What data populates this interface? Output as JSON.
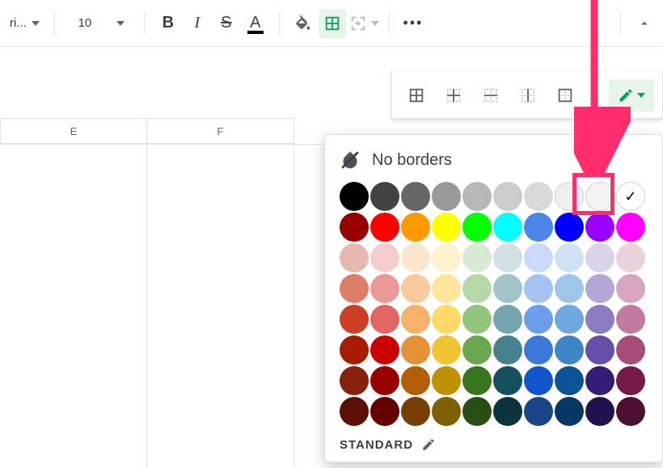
{
  "toolbar": {
    "font_name": "ri...",
    "font_size": "10",
    "bold": "B",
    "italic": "I",
    "strike": "S",
    "textcolor_letter": "A",
    "more": "•••"
  },
  "columns": [
    "E",
    "F"
  ],
  "borders_popup": {
    "pencil_color": "#0f9d58"
  },
  "color_popup": {
    "title": "No borders",
    "standard_label": "STANDARD",
    "selected_index": 9,
    "rows": [
      [
        "#000000",
        "#434343",
        "#666666",
        "#999999",
        "#b7b7b7",
        "#cccccc",
        "#d9d9d9",
        "#efefef",
        "#f3f3f3",
        "#ffffff"
      ],
      [
        "#980000",
        "#ff0000",
        "#ff9900",
        "#ffff00",
        "#00ff00",
        "#00ffff",
        "#4a86e8",
        "#0000ff",
        "#9900ff",
        "#ff00ff"
      ],
      [
        "#e6b8af",
        "#f4cccc",
        "#fce5cd",
        "#fff2cc",
        "#d9ead3",
        "#d0e0e3",
        "#c9daf8",
        "#cfe2f3",
        "#d9d2e9",
        "#ead1dc"
      ],
      [
        "#dd7e6b",
        "#ea9999",
        "#f9cb9c",
        "#ffe599",
        "#b6d7a8",
        "#a2c4c9",
        "#a4c2f4",
        "#9fc5e8",
        "#b4a7d6",
        "#d5a6bd"
      ],
      [
        "#cc4125",
        "#e06666",
        "#f6b26b",
        "#ffd966",
        "#93c47d",
        "#76a5af",
        "#6d9eeb",
        "#6fa8dc",
        "#8e7cc3",
        "#c27ba0"
      ],
      [
        "#a61c00",
        "#cc0000",
        "#e69138",
        "#f1c232",
        "#6aa84f",
        "#45818e",
        "#3c78d8",
        "#3d85c6",
        "#674ea7",
        "#a64d79"
      ],
      [
        "#85200c",
        "#990000",
        "#b45f06",
        "#bf9000",
        "#38761d",
        "#134f5c",
        "#1155cc",
        "#0b5394",
        "#351c75",
        "#741b47"
      ],
      [
        "#5b0f00",
        "#660000",
        "#783f04",
        "#7f6000",
        "#274e13",
        "#0c343d",
        "#1c4587",
        "#073763",
        "#20124d",
        "#4c1130"
      ]
    ]
  }
}
